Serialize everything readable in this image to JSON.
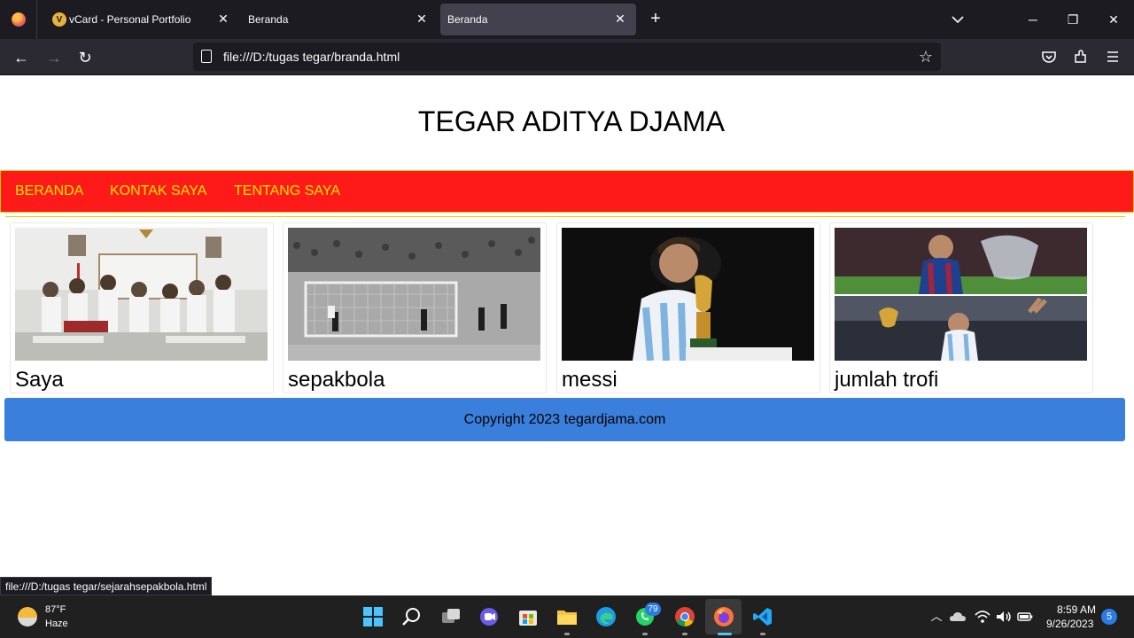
{
  "browser": {
    "tabs": [
      {
        "label": "vCard - Personal Portfolio",
        "favicon": "vcard-favicon",
        "active": false
      },
      {
        "label": "Beranda",
        "active": false
      },
      {
        "label": "Beranda",
        "active": true
      }
    ],
    "close_glyph": "✕",
    "new_tab_glyph": "+",
    "url": "file:///D:/tugas tegar/branda.html",
    "accent": "#42414d"
  },
  "page": {
    "site_title": "TEGAR ADITYA DJAMA",
    "menu": [
      "BERANDA",
      "KONTAK SAYA",
      "TENTANG SAYA"
    ],
    "menu_bg": "#ff1a1a",
    "menu_fg": "#ffe600",
    "cards": [
      {
        "caption": "Saya",
        "image": "class-group-photo"
      },
      {
        "caption": "sepakbola",
        "image": "vintage-football-match-photo"
      },
      {
        "caption": "messi",
        "image": "messi-kissing-world-cup-trophy"
      },
      {
        "caption": "jumlah trofi",
        "image": "messi-trophies-collage"
      }
    ],
    "footer": "Copyright 2023 tegardjama.com",
    "footer_bg": "#3a7fdb"
  },
  "status_link": "file:///D:/tugas tegar/sejarahsepakbola.html",
  "taskbar": {
    "weather_temp": "87°F",
    "weather_desc": "Haze",
    "whatsapp_badge": "79",
    "time": "8:59 AM",
    "date": "9/26/2023",
    "notifications": "5"
  }
}
